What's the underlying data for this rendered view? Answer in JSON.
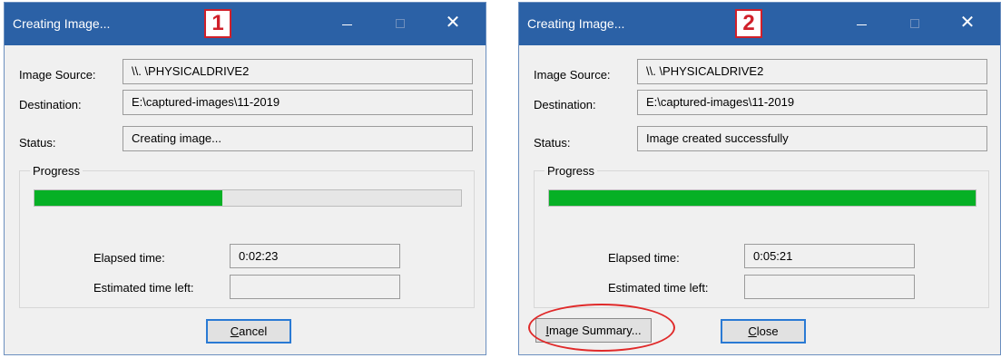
{
  "dialogs": [
    {
      "title": "Creating Image...",
      "step_number": "1",
      "controls": {
        "close_glyph": "✕"
      },
      "image_source_label": "Image Source:",
      "image_source": "\\\\. \\PHYSICALDRIVE2",
      "destination_label": "Destination:",
      "destination": "E:\\captured-images\\11-2019",
      "status_label": "Status:",
      "status": "Creating image...",
      "progress_label": "Progress",
      "progress_fraction": 0.44,
      "elapsed_label": "Elapsed time:",
      "elapsed": "0:02:23",
      "estimated_label": "Estimated time left:",
      "estimated": "",
      "cancel_label": "Cancel",
      "cancel_accel": "C"
    },
    {
      "title": "Creating Image...",
      "step_number": "2",
      "controls": {
        "close_glyph": "✕"
      },
      "image_source_label": "Image Source:",
      "image_source": "\\\\. \\PHYSICALDRIVE2",
      "destination_label": "Destination:",
      "destination": "E:\\captured-images\\11-2019",
      "status_label": "Status:",
      "status": "Image created successfully",
      "progress_label": "Progress",
      "progress_fraction": 1.0,
      "elapsed_label": "Elapsed time:",
      "elapsed": "0:05:21",
      "estimated_label": "Estimated time left:",
      "estimated": "",
      "summary_label": "Image Summary...",
      "summary_accel": "I",
      "close_label": "Close",
      "close_accel": "C"
    }
  ],
  "colors": {
    "titlebar": "#2b61a6",
    "progress_fill": "#06b025",
    "annotation_red": "#d0202a",
    "focus_border": "#2a7ad4"
  },
  "icons": [
    "minimize-icon",
    "maximize-icon",
    "close-icon"
  ]
}
